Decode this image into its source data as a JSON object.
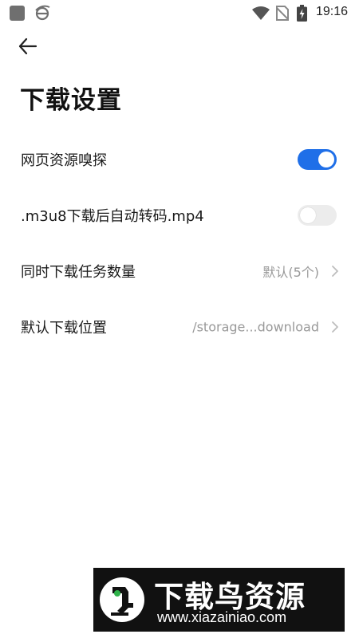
{
  "status_bar": {
    "time": "19:16"
  },
  "header": {
    "title": "下载设置"
  },
  "settings": [
    {
      "label": "网页资源嗅探",
      "type": "toggle",
      "enabled": true
    },
    {
      "label": ".m3u8下载后自动转码.mp4",
      "type": "toggle",
      "enabled": false
    },
    {
      "label": "同时下载任务数量",
      "type": "select",
      "value": "默认(5个)"
    },
    {
      "label": "默认下载位置",
      "type": "select",
      "value": "/storage...download"
    }
  ],
  "watermark": {
    "title": "下载鸟资源",
    "url": "www.xiazainiao.com"
  },
  "colors": {
    "accent": "#1f6fe8",
    "toggle_off": "#ececec",
    "secondary_text": "#999999"
  },
  "icons": [
    "back-arrow-icon",
    "chevron-right-icon",
    "wifi-icon",
    "no-sim-icon",
    "battery-icon",
    "browser-icon"
  ]
}
